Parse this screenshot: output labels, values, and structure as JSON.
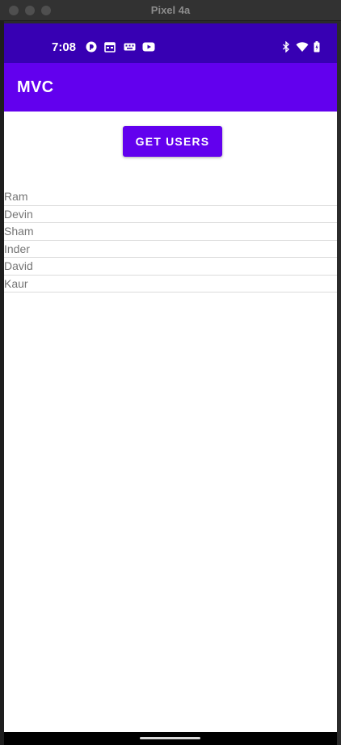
{
  "window": {
    "title": "Pixel 4a"
  },
  "status_bar": {
    "time": "7:08",
    "left_icons": [
      "pocket-casts-icon",
      "calendar-icon",
      "gboard-icon",
      "youtube-icon"
    ],
    "right_icons": [
      "bluetooth-icon",
      "wifi-icon",
      "battery-icon"
    ]
  },
  "app_bar": {
    "title": "MVC"
  },
  "main": {
    "get_users_label": "GET USERS",
    "users": [
      "Ram",
      "Devin",
      "Sham",
      "Inder",
      "David",
      "Kaur"
    ]
  },
  "colors": {
    "status_bar": "#3700b3",
    "primary": "#6200ee",
    "list_text": "#757575",
    "divider": "#dcdcdc"
  }
}
